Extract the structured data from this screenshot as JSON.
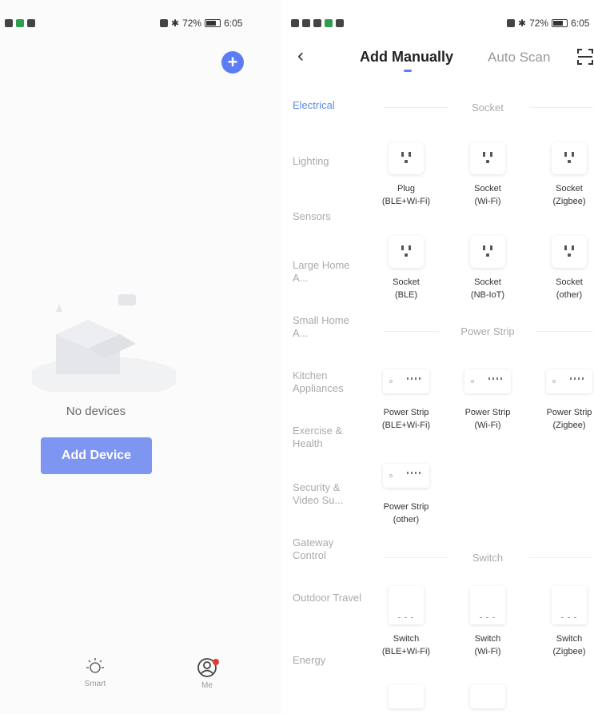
{
  "left_screen": {
    "status_bar": {
      "battery": "72%",
      "time": "6:05"
    },
    "add_icon": "plus-circle-icon",
    "empty_message": "No devices",
    "add_device_label": "Add Device",
    "tabs": [
      {
        "label": "Smart",
        "icon": "sun-icon"
      },
      {
        "label": "Me",
        "icon": "user-icon"
      }
    ]
  },
  "right_screen": {
    "status_bar": {
      "battery": "72%",
      "time": "6:05"
    },
    "header": {
      "title": "Add Manually",
      "auto_scan": "Auto Scan"
    },
    "categories": [
      "Electrical",
      "Lighting",
      "Sensors",
      "Large Home A...",
      "Small Home A...",
      "Kitchen Appliances",
      "Exercise & Health",
      "Security & Video Su...",
      "Gateway Control",
      "Outdoor Travel",
      "Energy"
    ],
    "active_category": "Electrical",
    "sections": [
      {
        "title": "Socket",
        "items": [
          {
            "name": "Plug",
            "sub": "(BLE+Wi-Fi)"
          },
          {
            "name": "Socket",
            "sub": "(Wi-Fi)"
          },
          {
            "name": "Socket",
            "sub": "(Zigbee)"
          },
          {
            "name": "Socket",
            "sub": "(BLE)"
          },
          {
            "name": "Socket",
            "sub": "(NB-IoT)"
          },
          {
            "name": "Socket",
            "sub": "(other)"
          }
        ]
      },
      {
        "title": "Power Strip",
        "items": [
          {
            "name": "Power Strip",
            "sub": "(BLE+Wi-Fi)"
          },
          {
            "name": "Power Strip",
            "sub": "(Wi-Fi)"
          },
          {
            "name": "Power Strip",
            "sub": "(Zigbee)"
          },
          {
            "name": "Power Strip",
            "sub": "(other)"
          }
        ]
      },
      {
        "title": "Switch",
        "items": [
          {
            "name": "Switch",
            "sub": "(BLE+Wi-Fi)"
          },
          {
            "name": "Switch",
            "sub": "(Wi-Fi)"
          },
          {
            "name": "Switch",
            "sub": "(Zigbee)"
          }
        ]
      }
    ]
  },
  "colors": {
    "accent": "#5b7cf5",
    "button": "#7f95f2",
    "active_category": "#5b8de8"
  }
}
